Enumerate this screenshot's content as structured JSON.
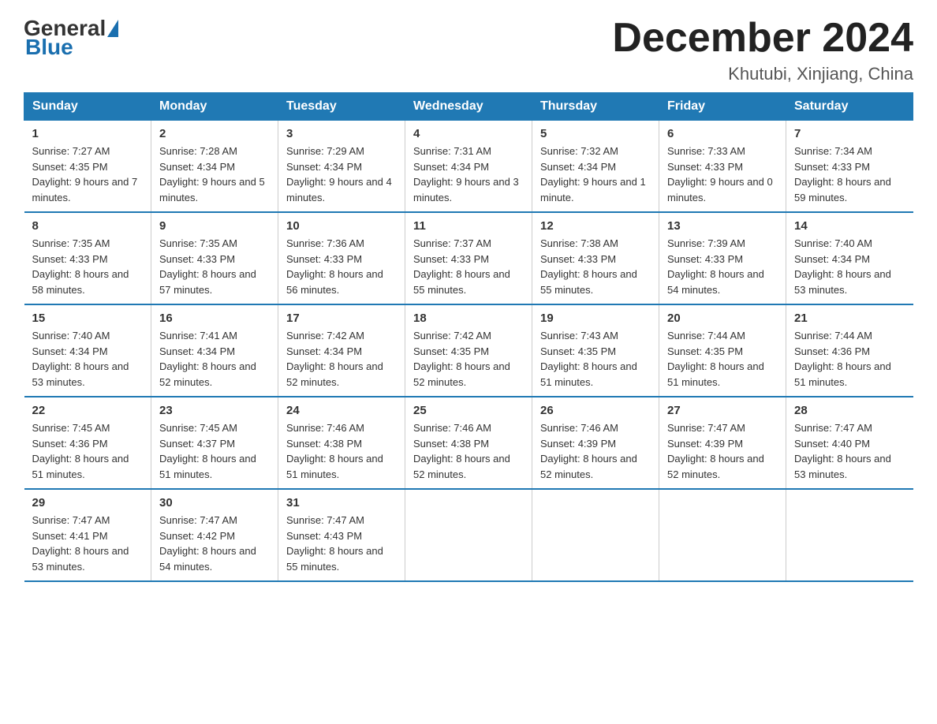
{
  "logo": {
    "general": "General",
    "blue": "Blue"
  },
  "title": "December 2024",
  "subtitle": "Khutubi, Xinjiang, China",
  "weekdays": [
    "Sunday",
    "Monday",
    "Tuesday",
    "Wednesday",
    "Thursday",
    "Friday",
    "Saturday"
  ],
  "weeks": [
    [
      {
        "day": "1",
        "sunrise": "7:27 AM",
        "sunset": "4:35 PM",
        "daylight": "9 hours and 7 minutes."
      },
      {
        "day": "2",
        "sunrise": "7:28 AM",
        "sunset": "4:34 PM",
        "daylight": "9 hours and 5 minutes."
      },
      {
        "day": "3",
        "sunrise": "7:29 AM",
        "sunset": "4:34 PM",
        "daylight": "9 hours and 4 minutes."
      },
      {
        "day": "4",
        "sunrise": "7:31 AM",
        "sunset": "4:34 PM",
        "daylight": "9 hours and 3 minutes."
      },
      {
        "day": "5",
        "sunrise": "7:32 AM",
        "sunset": "4:34 PM",
        "daylight": "9 hours and 1 minute."
      },
      {
        "day": "6",
        "sunrise": "7:33 AM",
        "sunset": "4:33 PM",
        "daylight": "9 hours and 0 minutes."
      },
      {
        "day": "7",
        "sunrise": "7:34 AM",
        "sunset": "4:33 PM",
        "daylight": "8 hours and 59 minutes."
      }
    ],
    [
      {
        "day": "8",
        "sunrise": "7:35 AM",
        "sunset": "4:33 PM",
        "daylight": "8 hours and 58 minutes."
      },
      {
        "day": "9",
        "sunrise": "7:35 AM",
        "sunset": "4:33 PM",
        "daylight": "8 hours and 57 minutes."
      },
      {
        "day": "10",
        "sunrise": "7:36 AM",
        "sunset": "4:33 PM",
        "daylight": "8 hours and 56 minutes."
      },
      {
        "day": "11",
        "sunrise": "7:37 AM",
        "sunset": "4:33 PM",
        "daylight": "8 hours and 55 minutes."
      },
      {
        "day": "12",
        "sunrise": "7:38 AM",
        "sunset": "4:33 PM",
        "daylight": "8 hours and 55 minutes."
      },
      {
        "day": "13",
        "sunrise": "7:39 AM",
        "sunset": "4:33 PM",
        "daylight": "8 hours and 54 minutes."
      },
      {
        "day": "14",
        "sunrise": "7:40 AM",
        "sunset": "4:34 PM",
        "daylight": "8 hours and 53 minutes."
      }
    ],
    [
      {
        "day": "15",
        "sunrise": "7:40 AM",
        "sunset": "4:34 PM",
        "daylight": "8 hours and 53 minutes."
      },
      {
        "day": "16",
        "sunrise": "7:41 AM",
        "sunset": "4:34 PM",
        "daylight": "8 hours and 52 minutes."
      },
      {
        "day": "17",
        "sunrise": "7:42 AM",
        "sunset": "4:34 PM",
        "daylight": "8 hours and 52 minutes."
      },
      {
        "day": "18",
        "sunrise": "7:42 AM",
        "sunset": "4:35 PM",
        "daylight": "8 hours and 52 minutes."
      },
      {
        "day": "19",
        "sunrise": "7:43 AM",
        "sunset": "4:35 PM",
        "daylight": "8 hours and 51 minutes."
      },
      {
        "day": "20",
        "sunrise": "7:44 AM",
        "sunset": "4:35 PM",
        "daylight": "8 hours and 51 minutes."
      },
      {
        "day": "21",
        "sunrise": "7:44 AM",
        "sunset": "4:36 PM",
        "daylight": "8 hours and 51 minutes."
      }
    ],
    [
      {
        "day": "22",
        "sunrise": "7:45 AM",
        "sunset": "4:36 PM",
        "daylight": "8 hours and 51 minutes."
      },
      {
        "day": "23",
        "sunrise": "7:45 AM",
        "sunset": "4:37 PM",
        "daylight": "8 hours and 51 minutes."
      },
      {
        "day": "24",
        "sunrise": "7:46 AM",
        "sunset": "4:38 PM",
        "daylight": "8 hours and 51 minutes."
      },
      {
        "day": "25",
        "sunrise": "7:46 AM",
        "sunset": "4:38 PM",
        "daylight": "8 hours and 52 minutes."
      },
      {
        "day": "26",
        "sunrise": "7:46 AM",
        "sunset": "4:39 PM",
        "daylight": "8 hours and 52 minutes."
      },
      {
        "day": "27",
        "sunrise": "7:47 AM",
        "sunset": "4:39 PM",
        "daylight": "8 hours and 52 minutes."
      },
      {
        "day": "28",
        "sunrise": "7:47 AM",
        "sunset": "4:40 PM",
        "daylight": "8 hours and 53 minutes."
      }
    ],
    [
      {
        "day": "29",
        "sunrise": "7:47 AM",
        "sunset": "4:41 PM",
        "daylight": "8 hours and 53 minutes."
      },
      {
        "day": "30",
        "sunrise": "7:47 AM",
        "sunset": "4:42 PM",
        "daylight": "8 hours and 54 minutes."
      },
      {
        "day": "31",
        "sunrise": "7:47 AM",
        "sunset": "4:43 PM",
        "daylight": "8 hours and 55 minutes."
      },
      null,
      null,
      null,
      null
    ]
  ]
}
